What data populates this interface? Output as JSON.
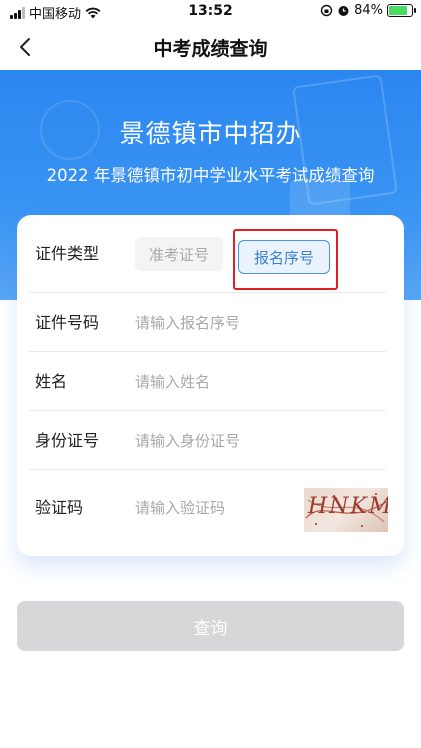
{
  "status_bar": {
    "carrier": "中国移动",
    "time": "13:52",
    "battery": "84%"
  },
  "nav": {
    "title": "中考成绩查询"
  },
  "banner": {
    "title": "景德镇市中招办",
    "subtitle": "2022 年景德镇市初中学业水平考试成绩查询"
  },
  "form": {
    "id_type": {
      "label": "证件类型",
      "options": [
        "准考证号",
        "报名序号"
      ],
      "selected": "报名序号"
    },
    "id_number": {
      "label": "证件号码",
      "placeholder": "请输入报名序号",
      "value": ""
    },
    "name": {
      "label": "姓名",
      "placeholder": "请输入姓名",
      "value": ""
    },
    "id_card": {
      "label": "身份证号",
      "placeholder": "请输入身份证号",
      "value": ""
    },
    "captcha": {
      "label": "验证码",
      "placeholder": "请输入验证码",
      "value": "",
      "image_text": "HNKM"
    }
  },
  "submit": {
    "label": "查询"
  },
  "colors": {
    "banner": "#3a94f3",
    "accent": "#4b92e0",
    "highlight": "#e02020",
    "button_disabled": "#d7d7d9"
  }
}
